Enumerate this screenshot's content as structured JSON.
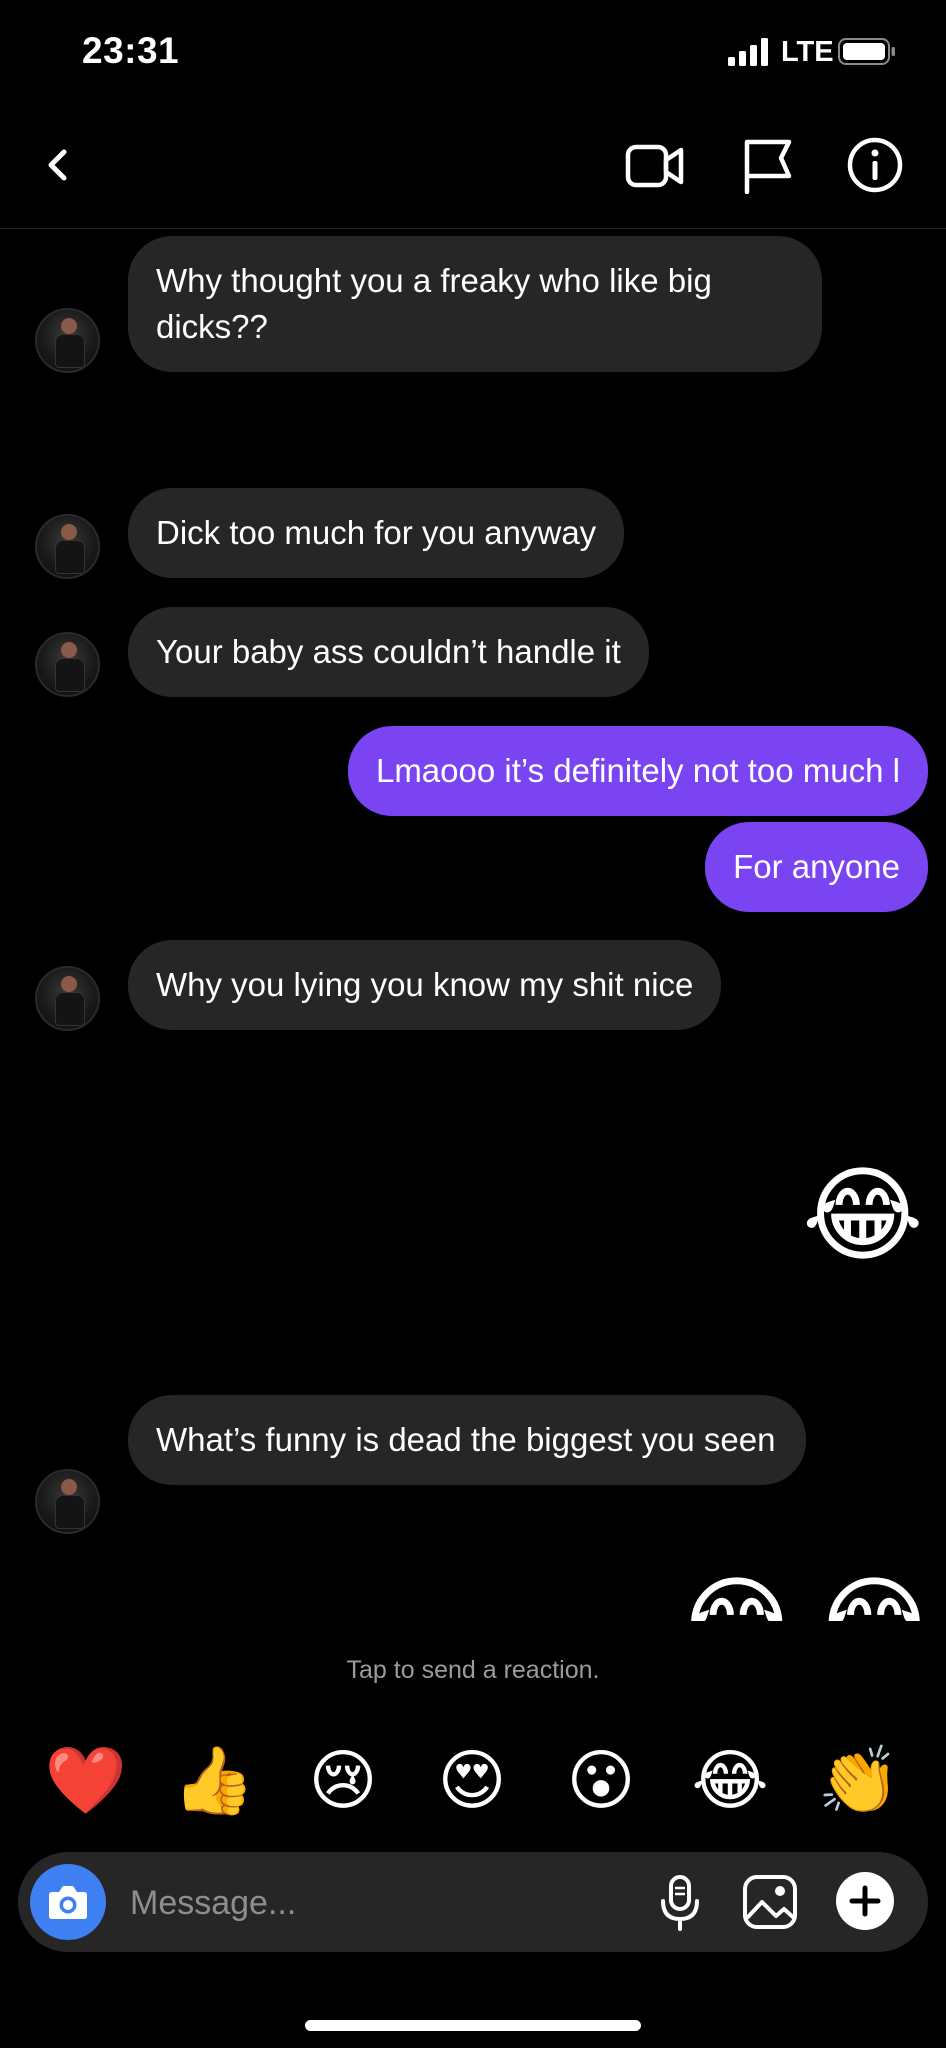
{
  "status_bar": {
    "time": "23:31",
    "network": "LTE"
  },
  "messages": [
    {
      "sender": "them",
      "text": "Why thought you a freaky who like big dicks??"
    },
    {
      "sender": "them",
      "text": "Dick too much for you anyway"
    },
    {
      "sender": "them",
      "text": "Your baby ass couldn’t handle it"
    },
    {
      "sender": "me",
      "text": "Lmaooo it’s definitely not too much l"
    },
    {
      "sender": "me",
      "text": "For anyone"
    },
    {
      "sender": "them",
      "text": "Why you lying you know my shit nice"
    },
    {
      "sender": "me",
      "text": "😂"
    },
    {
      "sender": "them",
      "text": "What’s funny is dead the biggest you seen"
    },
    {
      "sender": "me",
      "text": "😂😂"
    }
  ],
  "reaction_hint": "Tap to send a reaction.",
  "reactions": [
    "❤️",
    "👍",
    "😢",
    "😍",
    "😮",
    "😂",
    "👏"
  ],
  "composer": {
    "placeholder": "Message..."
  },
  "colors": {
    "outgoing_bubble": "#7a44f2",
    "incoming_bubble": "#262626",
    "camera_button": "#3e7ff2"
  }
}
